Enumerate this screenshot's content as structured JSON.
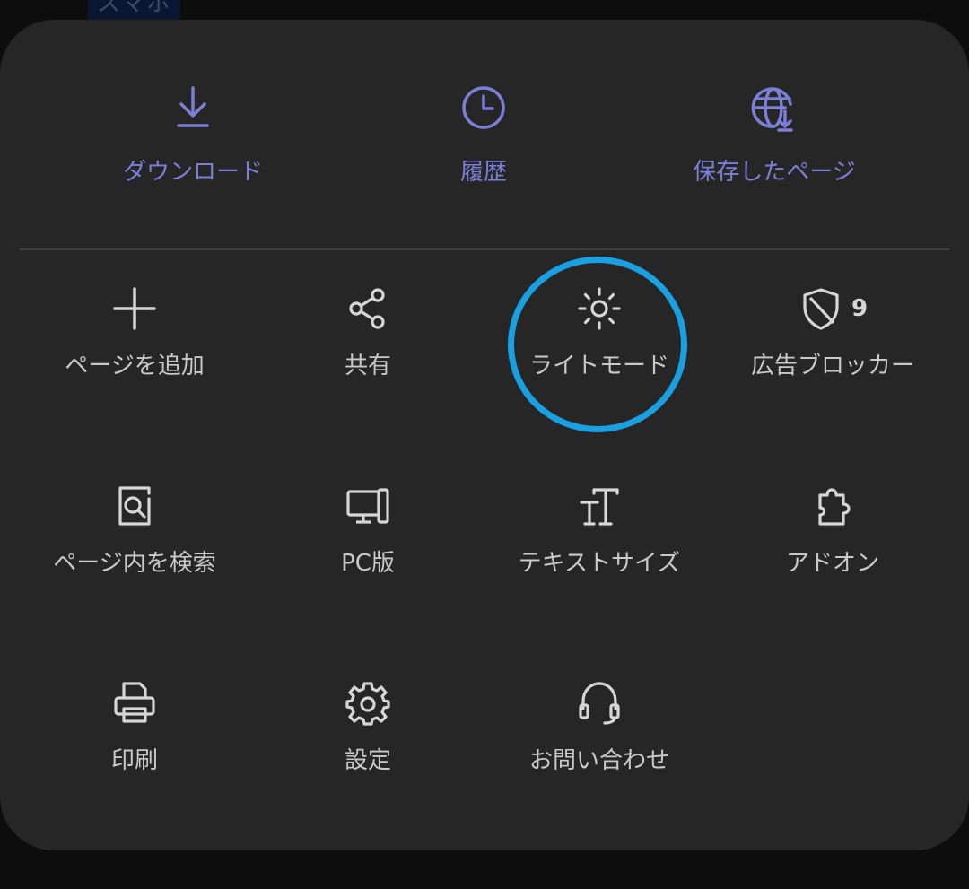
{
  "background_peek": {
    "text": "スマホ"
  },
  "top_actions": [
    {
      "label": "ダウンロード",
      "icon": "download-icon"
    },
    {
      "label": "履歴",
      "icon": "clock-icon"
    },
    {
      "label": "保存したページ",
      "icon": "saved-page-globe-icon"
    }
  ],
  "menu": [
    {
      "label": "ページを追加",
      "icon": "plus-icon"
    },
    {
      "label": "共有",
      "icon": "share-icon"
    },
    {
      "label": "ライトモード",
      "icon": "sun-icon"
    },
    {
      "label": "広告ブロッカー",
      "icon": "shield-icon",
      "badge": "9"
    },
    {
      "label": "ページ内を検索",
      "icon": "find-in-page-icon"
    },
    {
      "label": "PC版",
      "icon": "desktop-icon"
    },
    {
      "label": "テキストサイズ",
      "icon": "text-size-icon"
    },
    {
      "label": "アドオン",
      "icon": "puzzle-icon"
    },
    {
      "label": "印刷",
      "icon": "printer-icon"
    },
    {
      "label": "設定",
      "icon": "gear-icon"
    },
    {
      "label": "お問い合わせ",
      "icon": "headset-icon"
    }
  ],
  "colors": {
    "accent": "#7b7fd6",
    "sheet_background": "#262626",
    "label_text": "#c9c9c9",
    "highlight_ring": "#1a9fe0"
  }
}
